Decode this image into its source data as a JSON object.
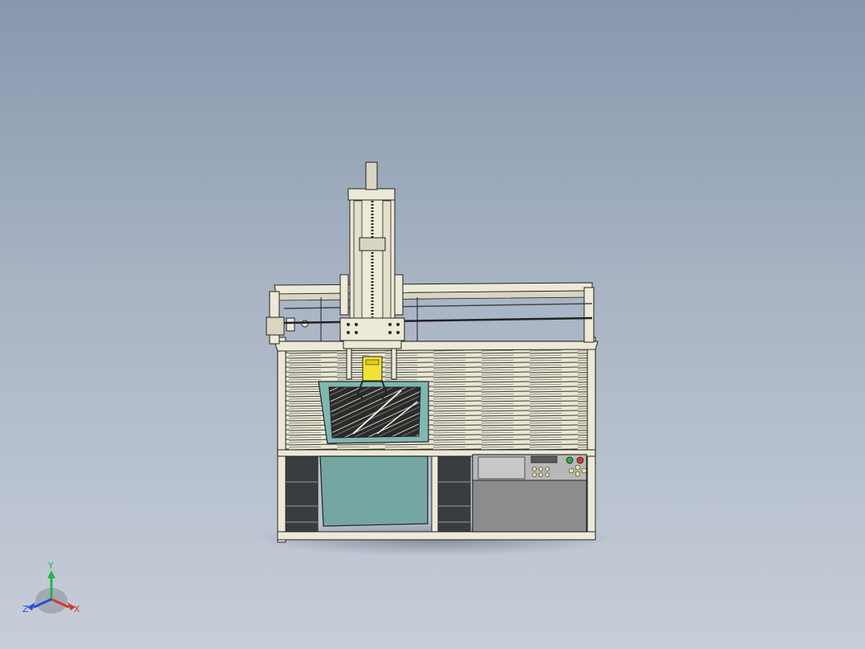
{
  "viewport": {
    "background_top": "#8798ad",
    "background_bottom": "#c7ced9"
  },
  "model": {
    "frame_color": "#ece9d6",
    "edge_color": "#2a2a2a",
    "glass_color": "#74a7a2",
    "gripper_color": "#f2e233",
    "control_panel_color": "#9a9a9a",
    "indicator_green": "#2fa84a",
    "indicator_red": "#d33a2c"
  },
  "triad": {
    "x_label": "X",
    "y_label": "Y",
    "z_label": "Z",
    "x_color": "#d23a2a",
    "y_color": "#2bb24c",
    "z_color": "#2a4bd8"
  }
}
